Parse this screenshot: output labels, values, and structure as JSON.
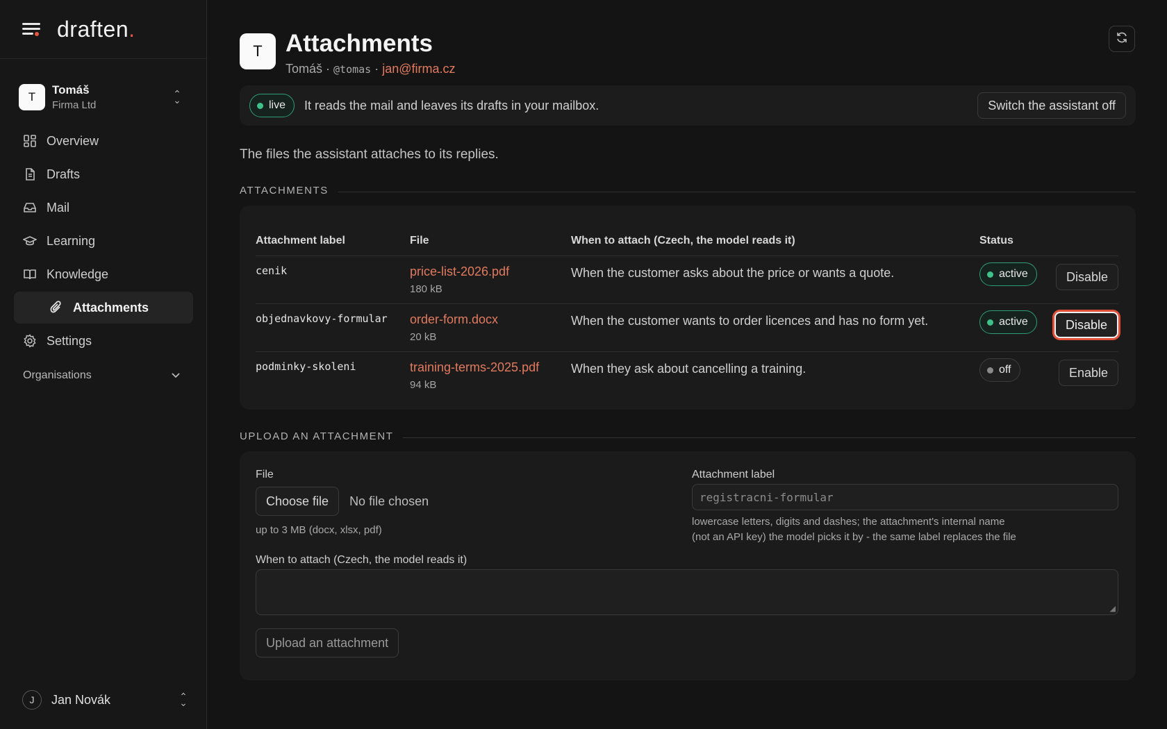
{
  "brand": {
    "name": "draften",
    "dot": "."
  },
  "sidebar": {
    "user": {
      "initial": "T",
      "name": "Tomáš",
      "org": "Firma Ltd"
    },
    "items": [
      {
        "label": "Overview",
        "icon": "grid-icon"
      },
      {
        "label": "Drafts",
        "icon": "document-icon"
      },
      {
        "label": "Mail",
        "icon": "inbox-icon"
      },
      {
        "label": "Learning",
        "icon": "graduation-cap-icon"
      },
      {
        "label": "Knowledge",
        "icon": "book-icon"
      },
      {
        "label": "Attachments",
        "icon": "paperclip-icon"
      },
      {
        "label": "Settings",
        "icon": "gear-icon"
      }
    ],
    "organisations_label": "Organisations",
    "bottom_user": {
      "initial": "J",
      "name": "Jan Novák"
    }
  },
  "header": {
    "initial": "T",
    "title": "Attachments",
    "user_name": "Tomáš",
    "sep": " · ",
    "handle": "@tomas",
    "email": "jan@firma.cz"
  },
  "status_bar": {
    "pill": "live",
    "text": "It reads the mail and leaves its drafts in your mailbox.",
    "switch_button": "Switch the assistant off"
  },
  "description": "The files the assistant attaches to its replies.",
  "attachments_section": {
    "heading": "ATTACHMENTS",
    "columns": [
      "Attachment label",
      "File",
      "When to attach (Czech, the model reads it)",
      "Status"
    ],
    "rows": [
      {
        "label": "cenik",
        "file": "price-list-2026.pdf",
        "size": "180 kB",
        "when": "When the customer asks about the price or wants a quote.",
        "status": "active",
        "action": "Disable"
      },
      {
        "label": "objednavkovy-formular",
        "file": "order-form.docx",
        "size": "20 kB",
        "when": "When the customer wants to order licences and has no form yet.",
        "status": "active",
        "action": "Disable"
      },
      {
        "label": "podminky-skoleni",
        "file": "training-terms-2025.pdf",
        "size": "94 kB",
        "when": "When they ask about cancelling a training.",
        "status": "off",
        "action": "Enable"
      }
    ]
  },
  "upload_section": {
    "heading": "UPLOAD AN ATTACHMENT",
    "file_label": "File",
    "choose_button": "Choose file",
    "no_file": "No file chosen",
    "file_hint": "up to 3 MB (docx, xlsx, pdf)",
    "label_label": "Attachment label",
    "label_placeholder": "registracni-formular",
    "label_hint_1": "lowercase letters, digits and dashes; the attachment's internal name",
    "label_hint_2": "(not an API key) the model picks it by - the same label replaces the file",
    "when_label": "When to attach (Czech, the model reads it)",
    "when_value": "",
    "submit_button": "Upload an attachment"
  },
  "colors": {
    "accent": "#e4573f",
    "link": "#e27a5f",
    "active_green": "#40c08a",
    "background": "#141414"
  }
}
